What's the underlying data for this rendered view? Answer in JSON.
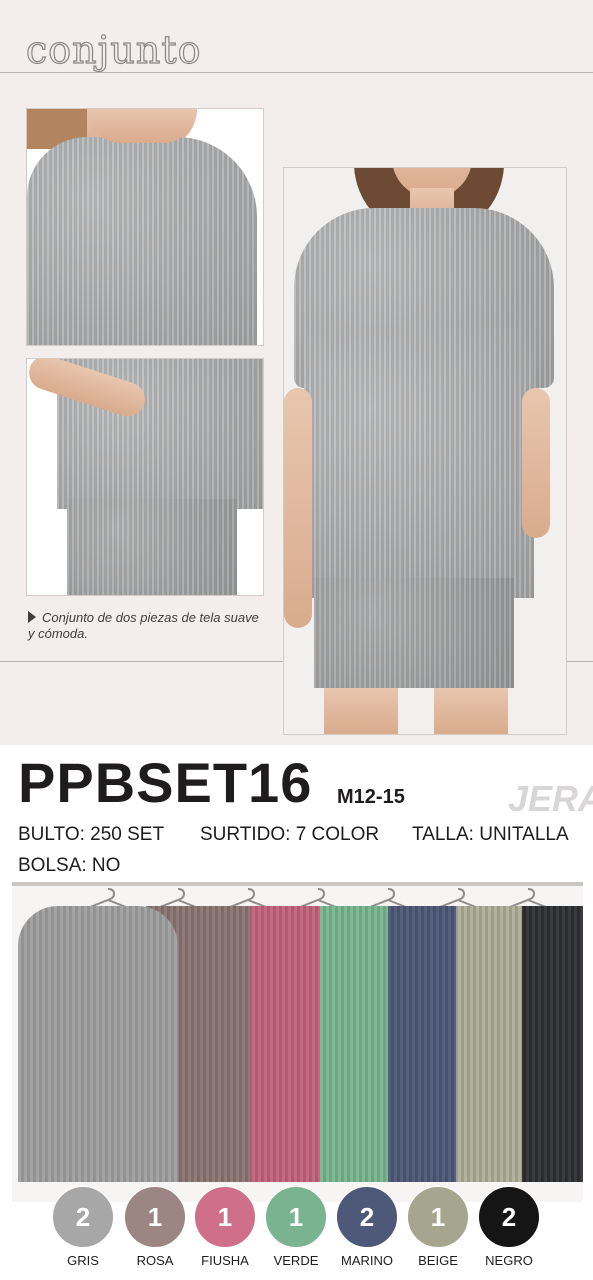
{
  "title": "conjunto",
  "caption": "Conjunto de dos piezas de tela suave y cómoda.",
  "product_code": "PPBSET16",
  "size_range": "M12-15",
  "brand": "JERA",
  "details": {
    "bulto": "BULTO: 250 SET",
    "surtido": "SURTIDO: 7 COLOR",
    "talla": "TALLA: UNITALLA",
    "bolsa": "BOLSA: NO"
  },
  "colors": [
    {
      "name": "GRIS",
      "qty": "2",
      "hex": "#a7a7a7",
      "text": "#ffffff"
    },
    {
      "name": "ROSA",
      "qty": "1",
      "hex": "#9c8684",
      "text": "#ffffff"
    },
    {
      "name": "FIUSHA",
      "qty": "1",
      "hex": "#cf6f89",
      "text": "#ffffff"
    },
    {
      "name": "VERDE",
      "qty": "1",
      "hex": "#7ab38f",
      "text": "#ffffff"
    },
    {
      "name": "MARINO",
      "qty": "2",
      "hex": "#4e5878",
      "text": "#ffffff"
    },
    {
      "name": "BEIGE",
      "qty": "1",
      "hex": "#a6a690",
      "text": "#ffffff"
    },
    {
      "name": "NEGRO",
      "qty": "2",
      "hex": "#151516",
      "text": "#ffffff"
    }
  ]
}
